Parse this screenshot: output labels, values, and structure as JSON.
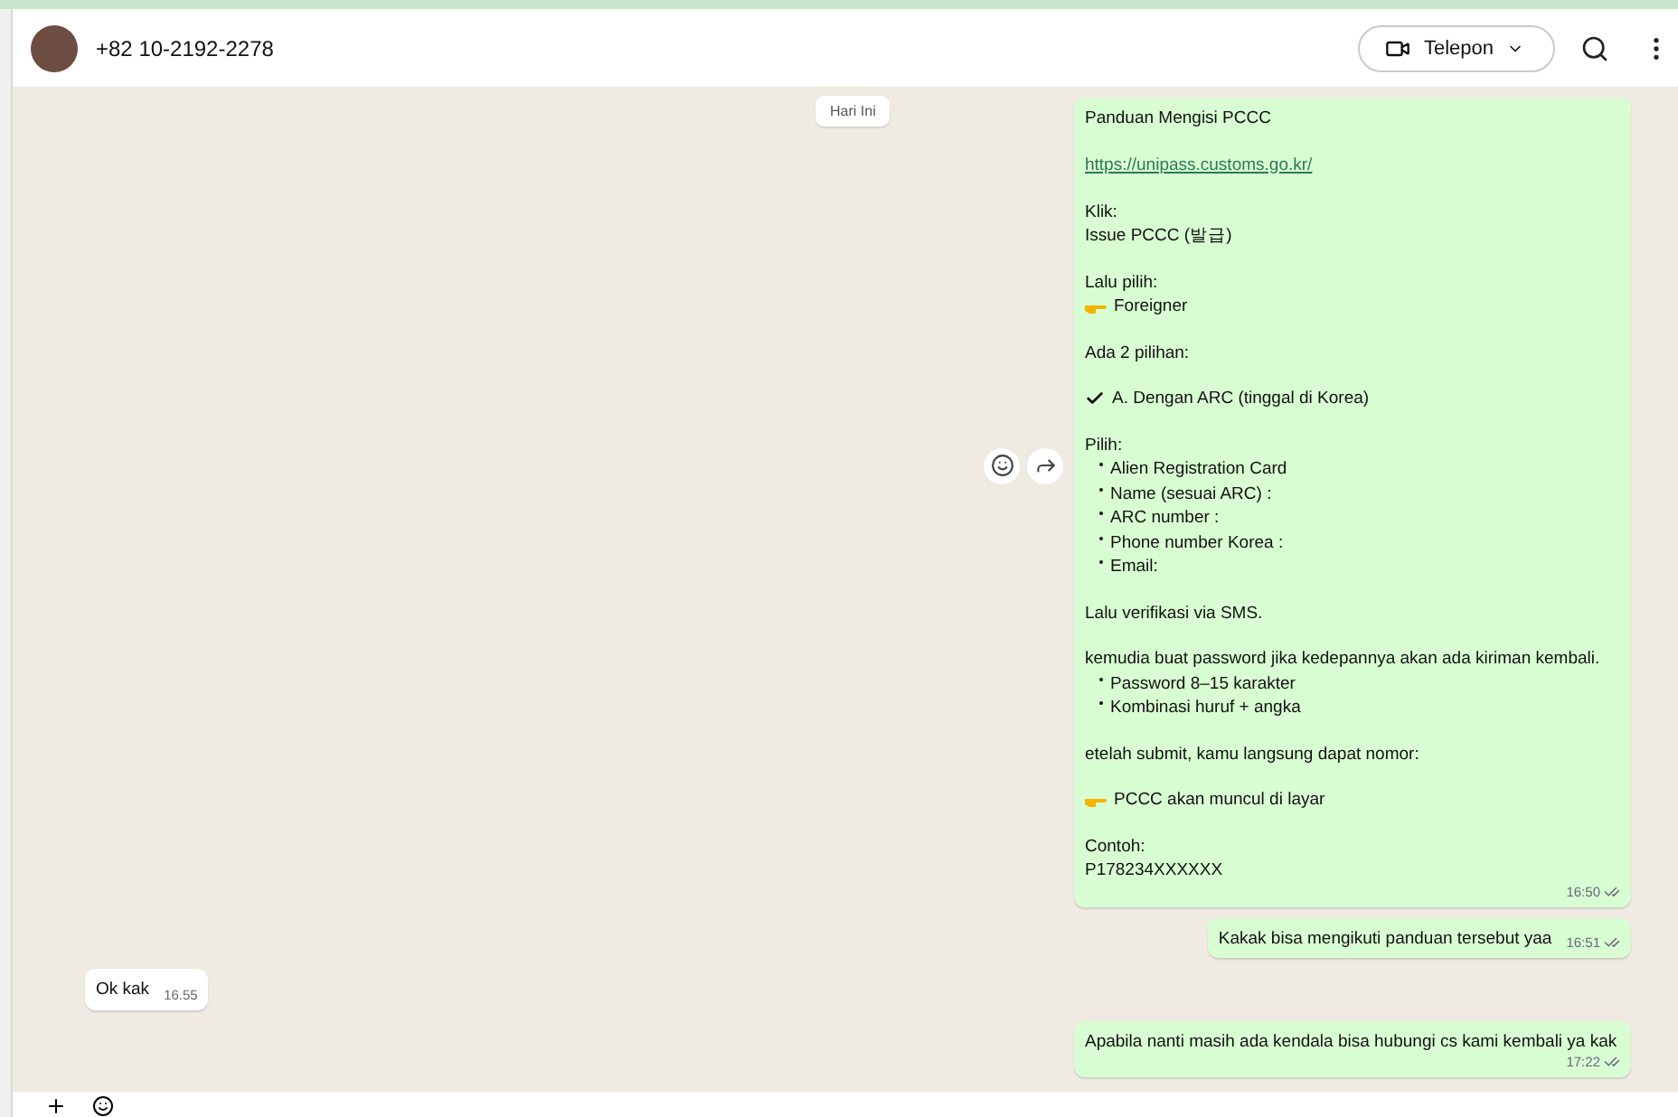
{
  "header": {
    "contact": "+82 10-2192-2278",
    "call_button": "Telepon"
  },
  "date_chip": "Hari Ini",
  "messages": [
    {
      "outgoing": true,
      "time": "16:50",
      "read": true,
      "paragraphs": [
        [
          {
            "kind": "text",
            "text": "Panduan Mengisi PCCC"
          }
        ],
        [
          {
            "kind": "link",
            "text": "https://unipass.customs.go.kr/"
          }
        ],
        [
          {
            "kind": "text",
            "text": "Klik:"
          },
          {
            "kind": "text",
            "text": "Issue PCCC (발급)"
          }
        ],
        [
          {
            "kind": "text",
            "text": "Lalu pilih:"
          },
          {
            "kind": "pointer",
            "text": "Foreigner"
          }
        ],
        [
          {
            "kind": "text",
            "text": "Ada 2 pilihan:"
          }
        ],
        [
          {
            "kind": "check",
            "text": "A. Dengan ARC (tinggal di Korea)"
          }
        ],
        [
          {
            "kind": "text",
            "text": "Pilih:"
          },
          {
            "kind": "bullet",
            "text": "Alien Registration Card"
          },
          {
            "kind": "bullet",
            "text": "Name (sesuai ARC) :"
          },
          {
            "kind": "bullet",
            "text": "ARC number :"
          },
          {
            "kind": "bullet",
            "text": "Phone number Korea :"
          },
          {
            "kind": "bullet",
            "text": "Email:"
          }
        ],
        [
          {
            "kind": "text",
            "text": "Lalu verifikasi via SMS."
          }
        ],
        [
          {
            "kind": "text",
            "text": "kemudia buat password jika kedepannya akan ada kiriman kembali."
          },
          {
            "kind": "bullet",
            "text": "Password 8–15 karakter"
          },
          {
            "kind": "bullet",
            "text": "Kombinasi huruf + angka"
          }
        ],
        [
          {
            "kind": "text",
            "text": "etelah submit, kamu langsung dapat nomor:"
          }
        ],
        [
          {
            "kind": "pointer",
            "text": "PCCC akan muncul di layar"
          }
        ],
        [
          {
            "kind": "text",
            "text": "Contoh:"
          },
          {
            "kind": "text",
            "text": "P178234XXXXXX"
          }
        ]
      ]
    },
    {
      "outgoing": true,
      "time": "16:51",
      "read": true,
      "paragraphs": [
        [
          {
            "kind": "text",
            "text": "Kakak bisa mengikuti panduan tersebut yaa"
          }
        ]
      ]
    },
    {
      "outgoing": false,
      "time": "16.55",
      "paragraphs": [
        [
          {
            "kind": "text",
            "text": "Ok kak"
          }
        ]
      ]
    },
    {
      "outgoing": true,
      "time": "17:22",
      "read": true,
      "paragraphs": [
        [
          {
            "kind": "text",
            "text": "Apabila nanti masih ada kendala bisa hubungi cs kami kembali ya kak"
          }
        ]
      ]
    }
  ]
}
